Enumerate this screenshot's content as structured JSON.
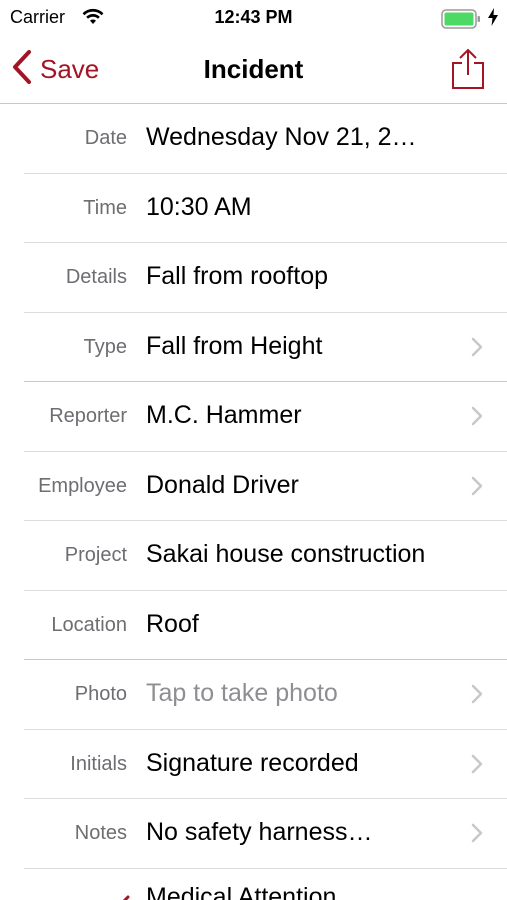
{
  "status_bar": {
    "carrier": "Carrier",
    "time": "12:43 PM",
    "icons": [
      "wifi-icon",
      "battery-icon",
      "charging-bolt-icon"
    ],
    "battery_color": "#4cd964"
  },
  "nav": {
    "back_label": "Save",
    "title": "Incident",
    "share_icon": "share-icon",
    "accent_color": "#a31424"
  },
  "form": {
    "rows": [
      {
        "label": "Date",
        "value": "Wednesday Nov 21, 2…",
        "chevron": false
      },
      {
        "label": "Time",
        "value": "10:30 AM",
        "chevron": false
      },
      {
        "label": "Details",
        "value": "Fall from rooftop",
        "chevron": false
      },
      {
        "label": "Type",
        "value": "Fall from Height",
        "chevron": true
      },
      {
        "label": "Reporter",
        "value": "M.C. Hammer",
        "chevron": true
      },
      {
        "label": "Employee",
        "value": "Donald Driver",
        "chevron": true
      },
      {
        "label": "Project",
        "value": "Sakai house construction",
        "chevron": false
      },
      {
        "label": "Location",
        "value": "Roof",
        "chevron": false
      },
      {
        "label": "Photo",
        "value": "Tap to take photo",
        "chevron": true,
        "placeholder": true
      },
      {
        "label": "Initials",
        "value": "Signature recorded",
        "chevron": true
      },
      {
        "label": "Notes",
        "value": "No safety harness…",
        "chevron": true
      }
    ],
    "partial_row": {
      "value": "Medical Attention",
      "checked": true
    }
  }
}
